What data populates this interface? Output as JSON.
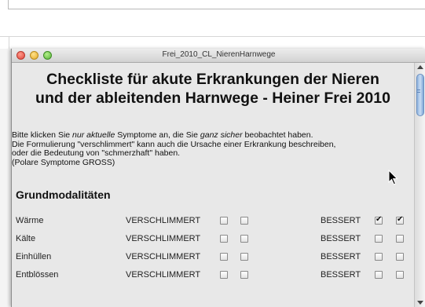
{
  "window": {
    "title": "Frei_2010_CL_NierenHarnwege"
  },
  "page": {
    "heading_line1": "Checkliste für akute Erkrankungen der Nieren",
    "heading_line2": "und der ableitenden Harnwege - Heiner Frei 2010",
    "intro_l1_a": " Bitte klicken Sie ",
    "intro_l1_b": "nur aktuelle",
    "intro_l1_c": " Symptome an, die Sie ",
    "intro_l1_d": "ganz sicher",
    "intro_l1_e": " beobachtet haben.",
    "intro_l2": " Die Formulierung \"verschlimmert\" kann auch die Ursache einer Erkrankung beschreiben,",
    "intro_l3": "oder die Bedeutung von \"schmerzhaft\" haben.",
    "intro_l4": " (Polare Symptome GROSS)",
    "section_title": "Grundmodalitäten"
  },
  "rows": [
    {
      "name": "Wärme",
      "worse_label": "VERSCHLIMMERT",
      "better_label": "BESSERT",
      "w1": false,
      "w2": false,
      "b1": true,
      "b2": true
    },
    {
      "name": "Kälte",
      "worse_label": "VERSCHLIMMERT",
      "better_label": "BESSERT",
      "w1": false,
      "w2": false,
      "b1": false,
      "b2": false
    },
    {
      "name": "Einhüllen",
      "worse_label": "VERSCHLIMMERT",
      "better_label": "BESSERT",
      "w1": false,
      "w2": false,
      "b1": false,
      "b2": false
    },
    {
      "name": "Entblössen",
      "worse_label": "VERSCHLIMMERT",
      "better_label": "BESSERT",
      "w1": false,
      "w2": false,
      "b1": false,
      "b2": false
    }
  ],
  "icons": {
    "close": "close-icon",
    "minimize": "minimize-icon",
    "maximize": "maximize-icon",
    "cursor": "arrow-cursor-icon"
  },
  "colors": {
    "window_bg": "#e8e8e8",
    "scroll_thumb": "#8fb3de"
  }
}
